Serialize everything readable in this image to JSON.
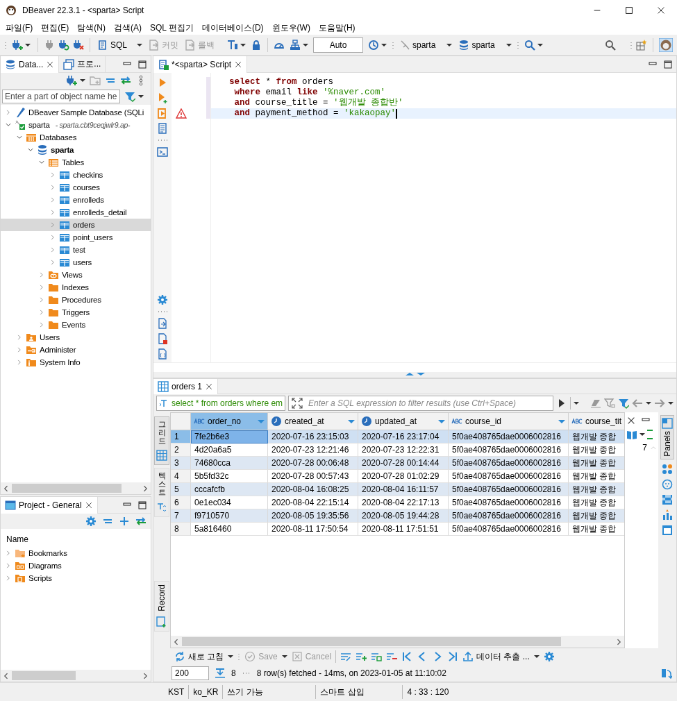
{
  "window": {
    "title": "DBeaver 22.3.1 - <sparta> Script"
  },
  "menu": [
    "파일(F)",
    "편집(E)",
    "탐색(N)",
    "검색(A)",
    "SQL 편집기",
    "데이터베이스(D)",
    "윈도우(W)",
    "도움말(H)"
  ],
  "toolbar": {
    "sql": "SQL",
    "commit": {
      "label": "커밋",
      "disabled": true
    },
    "rollback": {
      "label": "롤백",
      "disabled": true
    },
    "transaction_mode": "Auto",
    "datasource": "sparta",
    "schema": "sparta"
  },
  "navigator": {
    "tabs": [
      {
        "label": "Data...",
        "selected": true
      },
      {
        "label": "프로...",
        "selected": false
      }
    ],
    "filter": {
      "placeholder": "Enter a part of object name he"
    },
    "tree": [
      {
        "label": "DBeaver Sample Database (SQLi",
        "kind": "sample",
        "expanded": false,
        "selected": false
      },
      {
        "label": "sparta",
        "note": "- sparta.cbt9ceqjwlr9.ap-",
        "kind": "connection",
        "expanded": true,
        "selected": false,
        "children": [
          {
            "label": "Databases",
            "kind": "databases",
            "expanded": true,
            "selected": false,
            "children": [
              {
                "label": "sparta",
                "kind": "schema",
                "expanded": true,
                "selected": false,
                "children": [
                  {
                    "label": "Tables",
                    "kind": "tables",
                    "expanded": true,
                    "selected": false,
                    "children": [
                      {
                        "label": "checkins",
                        "kind": "table",
                        "expanded": false,
                        "selected": false
                      },
                      {
                        "label": "courses",
                        "kind": "table",
                        "expanded": false,
                        "selected": false
                      },
                      {
                        "label": "enrolleds",
                        "kind": "table",
                        "expanded": false,
                        "selected": false
                      },
                      {
                        "label": "enrolleds_detail",
                        "kind": "table",
                        "expanded": false,
                        "selected": false
                      },
                      {
                        "label": "orders",
                        "kind": "table",
                        "expanded": false,
                        "selected": true
                      },
                      {
                        "label": "point_users",
                        "kind": "table",
                        "expanded": false,
                        "selected": false
                      },
                      {
                        "label": "test",
                        "kind": "table",
                        "expanded": false,
                        "selected": false
                      },
                      {
                        "label": "users",
                        "kind": "table",
                        "expanded": false,
                        "selected": false
                      }
                    ]
                  },
                  {
                    "label": "Views",
                    "kind": "views",
                    "expanded": false,
                    "selected": false
                  },
                  {
                    "label": "Indexes",
                    "kind": "folder",
                    "expanded": false,
                    "selected": false
                  },
                  {
                    "label": "Procedures",
                    "kind": "folder",
                    "expanded": false,
                    "selected": false
                  },
                  {
                    "label": "Triggers",
                    "kind": "folder",
                    "expanded": false,
                    "selected": false
                  },
                  {
                    "label": "Events",
                    "kind": "folder",
                    "expanded": false,
                    "selected": false
                  }
                ]
              }
            ]
          },
          {
            "label": "Users",
            "kind": "users",
            "expanded": false,
            "selected": false
          },
          {
            "label": "Administer",
            "kind": "administer",
            "expanded": false,
            "selected": false
          },
          {
            "label": "System Info",
            "kind": "info",
            "expanded": false,
            "selected": false
          }
        ]
      }
    ]
  },
  "project": {
    "tab": "Project - General",
    "column": "Name",
    "items": [
      {
        "label": "Bookmarks",
        "kind": "bookmarks",
        "expanded": false
      },
      {
        "label": "Diagrams",
        "kind": "diagrams",
        "expanded": false
      },
      {
        "label": "Scripts",
        "kind": "scripts",
        "expanded": false
      }
    ]
  },
  "editor": {
    "tab": "*<sparta> Script",
    "lines": [
      {
        "current": false,
        "warning": false,
        "tokens": [
          {
            "text": "select",
            "kind": "keyword"
          },
          {
            "text": " * ",
            "kind": "plain"
          },
          {
            "text": "from",
            "kind": "keyword"
          },
          {
            "text": " orders",
            "kind": "plain"
          }
        ]
      },
      {
        "current": false,
        "warning": false,
        "tokens": [
          {
            "text": " where",
            "kind": "keyword"
          },
          {
            "text": " email ",
            "kind": "plain"
          },
          {
            "text": "like",
            "kind": "keyword"
          },
          {
            "text": " '%naver.com'",
            "kind": "string"
          }
        ]
      },
      {
        "current": false,
        "warning": false,
        "tokens": [
          {
            "text": " and",
            "kind": "keyword"
          },
          {
            "text": " course_title = ",
            "kind": "plain"
          },
          {
            "text": "'웹개발 종합반'",
            "kind": "string"
          }
        ]
      },
      {
        "current": true,
        "warning": true,
        "tokens": [
          {
            "text": " and",
            "kind": "keyword"
          },
          {
            "text": " payment_method = ",
            "kind": "plain"
          },
          {
            "text": "'kakaopay'",
            "kind": "string"
          }
        ]
      }
    ]
  },
  "results": {
    "tab": "orders 1",
    "query": "select * from orders where em",
    "filter": {
      "placeholder": "Enter a SQL expression to filter results (use Ctrl+Space)"
    },
    "side_tabs": [
      {
        "label": "그리드",
        "selected": true
      },
      {
        "label": "텍스트",
        "selected": false
      }
    ],
    "record": "Record",
    "columns": [
      {
        "name": "order_no",
        "kind": "text",
        "selected": true
      },
      {
        "name": "created_at",
        "kind": "datetime",
        "selected": false
      },
      {
        "name": "updated_at",
        "kind": "datetime",
        "selected": false
      },
      {
        "name": "course_id",
        "kind": "text",
        "selected": false
      },
      {
        "name": "course_tit",
        "kind": "text",
        "selected": false
      }
    ],
    "rows": [
      {
        "num": "1",
        "selected": true,
        "cells": [
          "7fe2b6e3",
          "2020-07-16 23:15:03",
          "2020-07-16 23:17:04",
          "5f0ae408765dae0006002816",
          "웹개발 종합"
        ]
      },
      {
        "num": "2",
        "selected": false,
        "cells": [
          "4d20a6a5",
          "2020-07-23 12:21:46",
          "2020-07-23 12:22:31",
          "5f0ae408765dae0006002816",
          "웹개발 종합"
        ]
      },
      {
        "num": "3",
        "selected": false,
        "cells": [
          "74680cca",
          "2020-07-28 00:06:48",
          "2020-07-28 00:14:44",
          "5f0ae408765dae0006002816",
          "웹개발 종합"
        ]
      },
      {
        "num": "4",
        "selected": false,
        "cells": [
          "5b5fd32c",
          "2020-07-28 00:57:43",
          "2020-07-28 01:02:29",
          "5f0ae408765dae0006002816",
          "웹개발 종합"
        ]
      },
      {
        "num": "5",
        "selected": false,
        "cells": [
          "cccafcfb",
          "2020-08-04 16:08:25",
          "2020-08-04 16:11:57",
          "5f0ae408765dae0006002816",
          "웹개발 종합"
        ]
      },
      {
        "num": "6",
        "selected": false,
        "cells": [
          "0e1ec034",
          "2020-08-04 22:15:14",
          "2020-08-04 22:17:13",
          "5f0ae408765dae0006002816",
          "웹개발 종합"
        ]
      },
      {
        "num": "7",
        "selected": false,
        "cells": [
          "f9710570",
          "2020-08-05 19:35:56",
          "2020-08-05 19:44:28",
          "5f0ae408765dae0006002816",
          "웹개발 종합"
        ]
      },
      {
        "num": "8",
        "selected": false,
        "cells": [
          "5a816460",
          "2020-08-11 17:50:54",
          "2020-08-11 17:51:51",
          "5f0ae408765dae0006002816",
          "웹개발 종합"
        ]
      }
    ],
    "panel_value": "7",
    "panels_tab": "Panels",
    "actions": [
      {
        "label": "새로 고침",
        "kind": "refresh",
        "disabled": false
      },
      {
        "label": "Save",
        "kind": "save",
        "disabled": true
      },
      {
        "label": "Cancel",
        "kind": "cancel",
        "disabled": true
      }
    ],
    "export": "데이터 추출 ...",
    "fetch_size": "200",
    "row_count": "8",
    "status": "8 row(s) fetched - 14ms, on 2023-01-05 at 11:10:02"
  },
  "status_bar": [
    "KST",
    "ko_KR",
    "쓰기 가능",
    "스마트 삽입",
    "4 : 33 : 120"
  ]
}
